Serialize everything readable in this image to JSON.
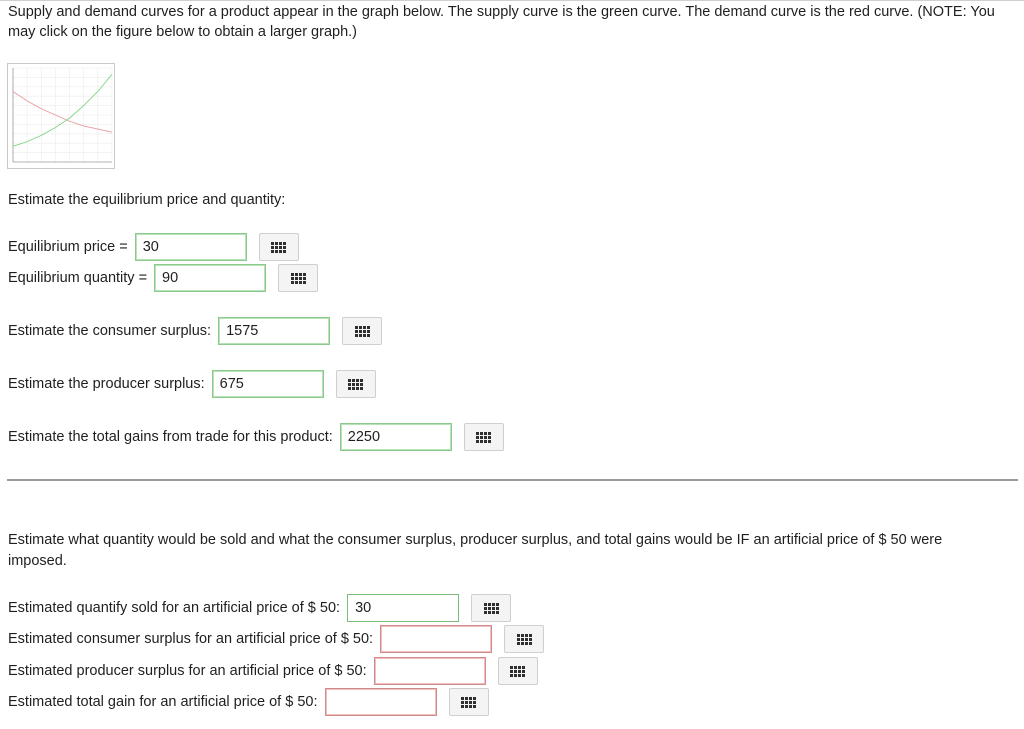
{
  "question": {
    "intro": "Supply and demand curves for a product appear in the graph below. The supply curve is the green curve. The demand curve is the red curve. (NOTE: You may click on the figure below to obtain a larger graph.)"
  },
  "figure": {
    "supply_color": "#7fd37f",
    "demand_color": "#e89a9a",
    "supply_points": [
      [
        0,
        10
      ],
      [
        20,
        13
      ],
      [
        40,
        17
      ],
      [
        60,
        22
      ],
      [
        80,
        28
      ],
      [
        100,
        36
      ],
      [
        120,
        45
      ],
      [
        140,
        56
      ]
    ],
    "demand_points": [
      [
        0,
        45
      ],
      [
        20,
        39
      ],
      [
        40,
        34
      ],
      [
        60,
        30
      ],
      [
        80,
        26
      ],
      [
        100,
        23
      ],
      [
        120,
        21
      ],
      [
        140,
        19
      ]
    ]
  },
  "part1": {
    "prompt": "Estimate the equilibrium price and quantity:",
    "price_label": "Equilibrium price =",
    "price_value": "30",
    "quantity_label": "Equilibrium quantity =",
    "quantity_value": "90",
    "cs_label": "Estimate the consumer surplus:",
    "cs_value": "1575",
    "ps_label": "Estimate the producer surplus:",
    "ps_value": "675",
    "tg_label": "Estimate the total gains from trade for this product:",
    "tg_value": "2250"
  },
  "part2": {
    "prompt": "Estimate what quantity would be sold and what the consumer surplus, producer surplus, and total gains would be IF an artificial price of $ 50 were imposed.",
    "qty_label": "Estimated quantify sold for an artificial price of $ 50:",
    "qty_value": "30",
    "cs_label": "Estimated consumer surplus for an artificial price of $ 50:",
    "cs_value": "",
    "ps_label": "Estimated producer surplus for an artificial price of $ 50:",
    "ps_value": "",
    "tg_label": "Estimated total gain for an artificial price of $ 50:",
    "tg_value": ""
  },
  "icons": {
    "keypad": "keypad-icon"
  }
}
